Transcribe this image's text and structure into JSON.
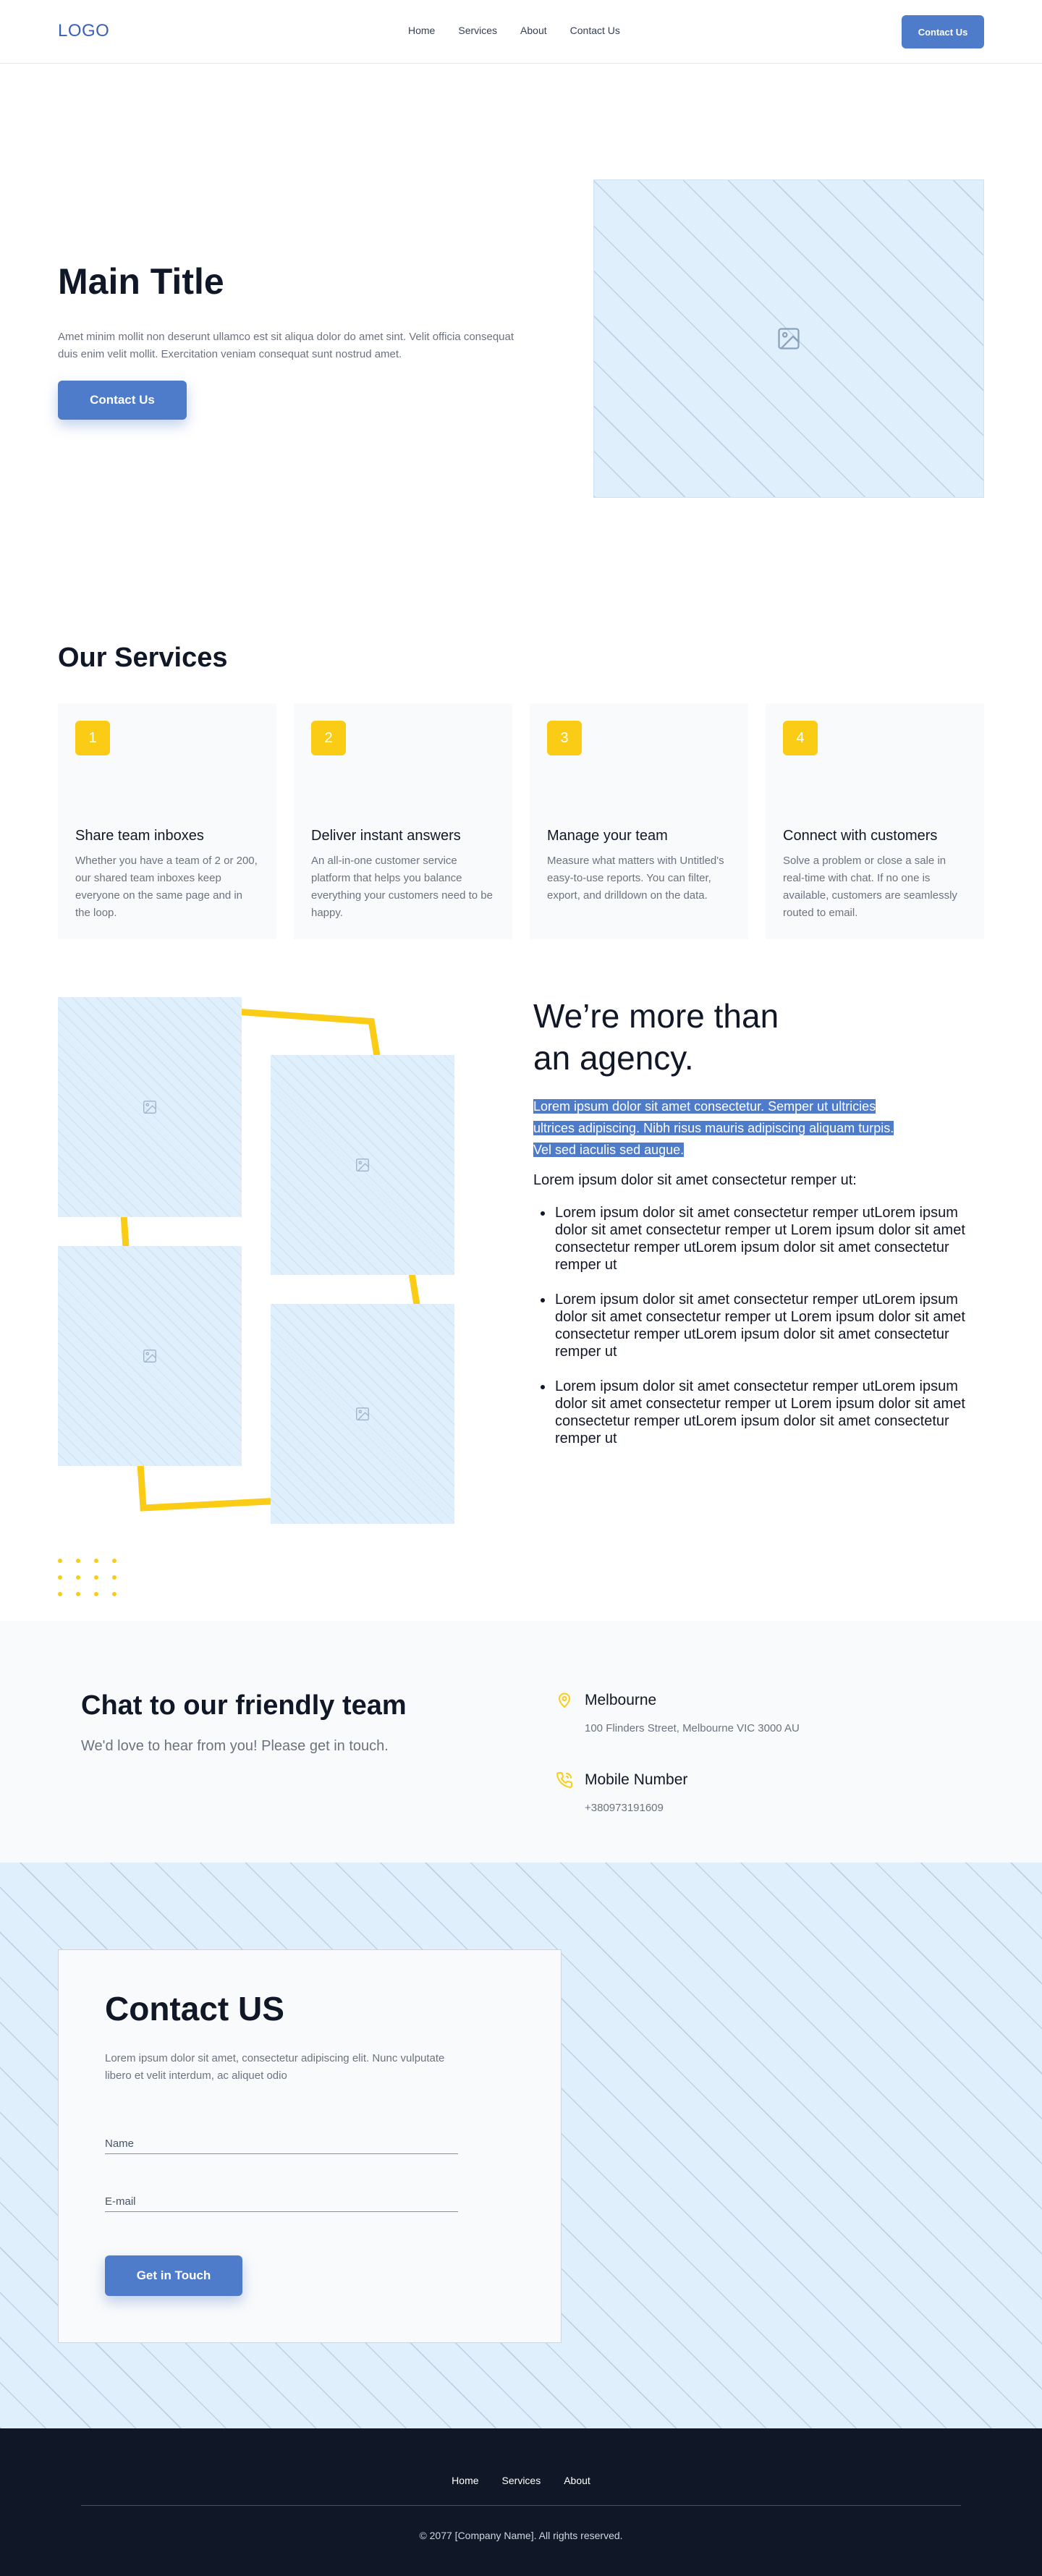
{
  "nav": {
    "logo": "LOGO",
    "links": [
      "Home",
      "Services",
      "About",
      "Contact Us"
    ],
    "cta": "Contact Us"
  },
  "hero": {
    "title": "Main Title",
    "text": "Amet minim mollit non deserunt ullamco est sit aliqua dolor do amet sint. Velit officia consequat duis enim velit mollit. Exercitation veniam consequat sunt nostrud amet.",
    "cta": "Contact Us",
    "image_icon": "image-icon"
  },
  "services": {
    "title": "Our Services",
    "cards": [
      {
        "number": "1",
        "title": "Share team inboxes",
        "text": "Whether you have a team of 2 or 200, our shared team inboxes keep everyone on the same page and in the loop."
      },
      {
        "number": "2",
        "title": "Deliver instant answers",
        "text": "An all-in-one customer service platform that helps you balance everything your customers need to be happy."
      },
      {
        "number": "3",
        "title": "Manage your team",
        "text": "Measure what matters with Untitled's easy-to-use reports. You can filter, export, and drilldown on the data."
      },
      {
        "number": "4",
        "title": "Connect with customers",
        "text": "Solve a problem or close a sale in real-time with chat. If no one is available, customers are seamlessly routed to email."
      }
    ]
  },
  "agency": {
    "title_line1": "We’re more than",
    "title_line2": "an agency.",
    "highlight_lines": [
      "Lorem ipsum dolor sit amet consectetur. Semper ut ultricies",
      "ultrices adipiscing. Nibh risus mauris adipiscing aliquam turpis.",
      "Vel sed iaculis sed augue."
    ],
    "subtitle": "Lorem ipsum dolor sit amet consectetur remper ut:",
    "bullets": [
      "Lorem ipsum dolor sit amet consectetur remper utLorem ipsum dolor sit amet consectetur remper ut Lorem ipsum dolor sit amet consectetur remper utLorem ipsum dolor sit amet consectetur remper ut",
      "Lorem ipsum dolor sit amet consectetur remper utLorem ipsum dolor sit amet consectetur remper ut Lorem ipsum dolor sit amet consectetur remper utLorem ipsum dolor sit amet consectetur remper ut",
      "Lorem ipsum dolor sit amet consectetur remper utLorem ipsum dolor sit amet consectetur remper ut Lorem ipsum dolor sit amet consectetur remper utLorem ipsum dolor sit amet consectetur remper ut"
    ]
  },
  "chat": {
    "title": "Chat to our friendly team",
    "subtitle": "We'd love to hear from you! Please get in touch.",
    "location_title": "Melbourne",
    "location_text": "100 Flinders Street, Melbourne VIC 3000 AU",
    "phone_title": "Mobile Number",
    "phone_text": "+380973191609"
  },
  "contact": {
    "title": "Contact US",
    "text": "Lorem ipsum dolor sit amet, consectetur adipiscing elit. Nunc vulputate libero et velit interdum, ac aliquet odio",
    "name_placeholder": "Name",
    "email_placeholder": "E-mail",
    "cta": "Get in Touch"
  },
  "footer": {
    "links": [
      "Home",
      "Services",
      "About"
    ],
    "copyright": "© 2077 [Company Name]. All rights reserved."
  },
  "colors": {
    "brand": "#4f7bcb",
    "accent": "#facc15",
    "dark": "#101828"
  }
}
